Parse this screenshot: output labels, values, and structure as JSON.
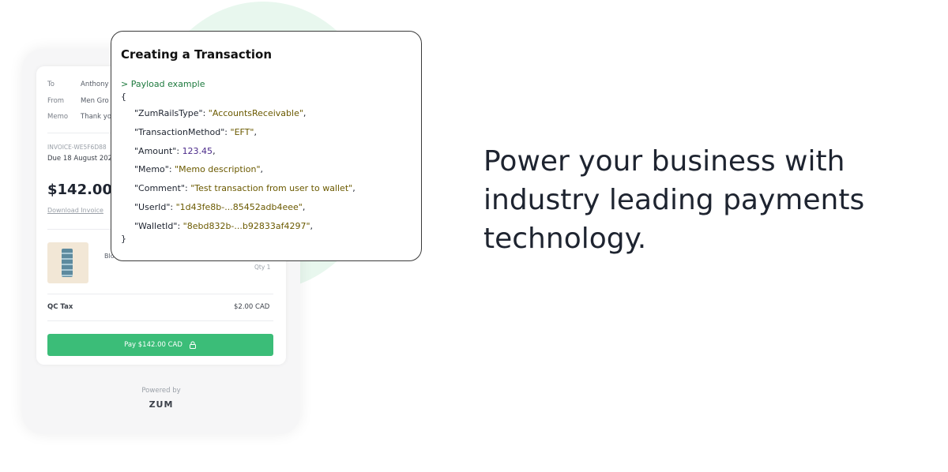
{
  "invoice": {
    "to_label": "To",
    "to_value": "Anthony",
    "from_label": "From",
    "from_value": "Men Gro",
    "memo_label": "Memo",
    "memo_value": "Thank yo",
    "invoice_number": "INVOICE-WE5F6D88",
    "due_date": "Due 18 August 202",
    "amount": "$142.00",
    "download_link": "Download Invoice",
    "item_name": "Blo",
    "item_qty": "Qty 1",
    "tax_label": "QC Tax",
    "tax_value": "$2.00 CAD",
    "pay_button": "Pay $142.00 CAD",
    "powered_by": "Powered by",
    "brand": "ZUM"
  },
  "code_card": {
    "title": "Creating a Transaction",
    "comment": "> Payload example",
    "open_brace": "{",
    "close_brace": "}",
    "lines": [
      {
        "key": "\"ZumRailsType\": ",
        "value": "\"AccountsReceivable\"",
        "value_type": "string",
        "tail": ","
      },
      {
        "key": "\"TransactionMethod\": ",
        "value": "\"EFT\"",
        "value_type": "string",
        "tail": ","
      },
      {
        "key": "\"Amount\": ",
        "value": "123.45",
        "value_type": "number",
        "tail": ","
      },
      {
        "key": "\"Memo\": ",
        "value": "\"Memo description\"",
        "value_type": "string",
        "tail": ","
      },
      {
        "key": "\"Comment\": ",
        "value": "\"Test transaction from user to wallet\"",
        "value_type": "string",
        "tail": ","
      },
      {
        "key": "\"UserId\": ",
        "value": "\"1d43fe8b-...85452adb4eee\"",
        "value_type": "string",
        "tail": ","
      },
      {
        "key": "\"WalletId\": ",
        "value": "\"8ebd832b-...b92833af4297\"",
        "value_type": "string",
        "tail": ","
      }
    ]
  },
  "headline": {
    "line1": "Power your business with",
    "line2": "industry leading payments",
    "line3": "technology."
  },
  "colors": {
    "accent_green": "#3bbd78",
    "blob": "#e8f7ee",
    "code_comment": "#1e7a3e",
    "text_dark": "#1e2430"
  }
}
